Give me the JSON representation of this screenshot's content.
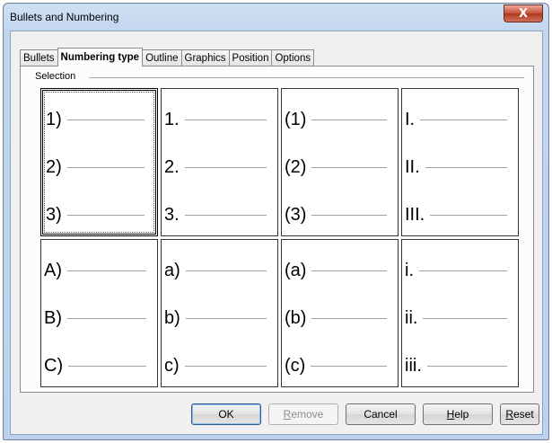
{
  "window": {
    "title": "Bullets and Numbering",
    "close_glyph": "X"
  },
  "tabs": [
    {
      "label": "Bullets",
      "active": false
    },
    {
      "label": "Numbering type",
      "active": true
    },
    {
      "label": "Outline",
      "active": false
    },
    {
      "label": "Graphics",
      "active": false
    },
    {
      "label": "Position",
      "active": false
    },
    {
      "label": "Options",
      "active": false
    }
  ],
  "selection": {
    "label": "Selection",
    "presets": [
      {
        "labels": [
          "1)",
          "2)",
          "3)"
        ],
        "selected": true
      },
      {
        "labels": [
          "1.",
          "2.",
          "3."
        ],
        "selected": false
      },
      {
        "labels": [
          "(1)",
          "(2)",
          "(3)"
        ],
        "selected": false
      },
      {
        "labels": [
          "I.",
          "II.",
          "III."
        ],
        "selected": false
      },
      {
        "labels": [
          "A)",
          "B)",
          "C)"
        ],
        "selected": false
      },
      {
        "labels": [
          "a)",
          "b)",
          "c)"
        ],
        "selected": false
      },
      {
        "labels": [
          "(a)",
          "(b)",
          "(c)"
        ],
        "selected": false
      },
      {
        "labels": [
          "i.",
          "ii.",
          "iii."
        ],
        "selected": false
      }
    ]
  },
  "buttons": {
    "ok": "OK",
    "remove": {
      "mnemonic": "R",
      "rest": "emove",
      "enabled": false
    },
    "cancel": "Cancel",
    "help": {
      "mnemonic": "H",
      "rest": "elp"
    },
    "reset": {
      "mnemonic": "R",
      "rest": "eset"
    }
  },
  "colors": {
    "title_bar": "#c2d6ee",
    "close_button": "#c7503a",
    "dialog_face": "#f0f0f0"
  }
}
